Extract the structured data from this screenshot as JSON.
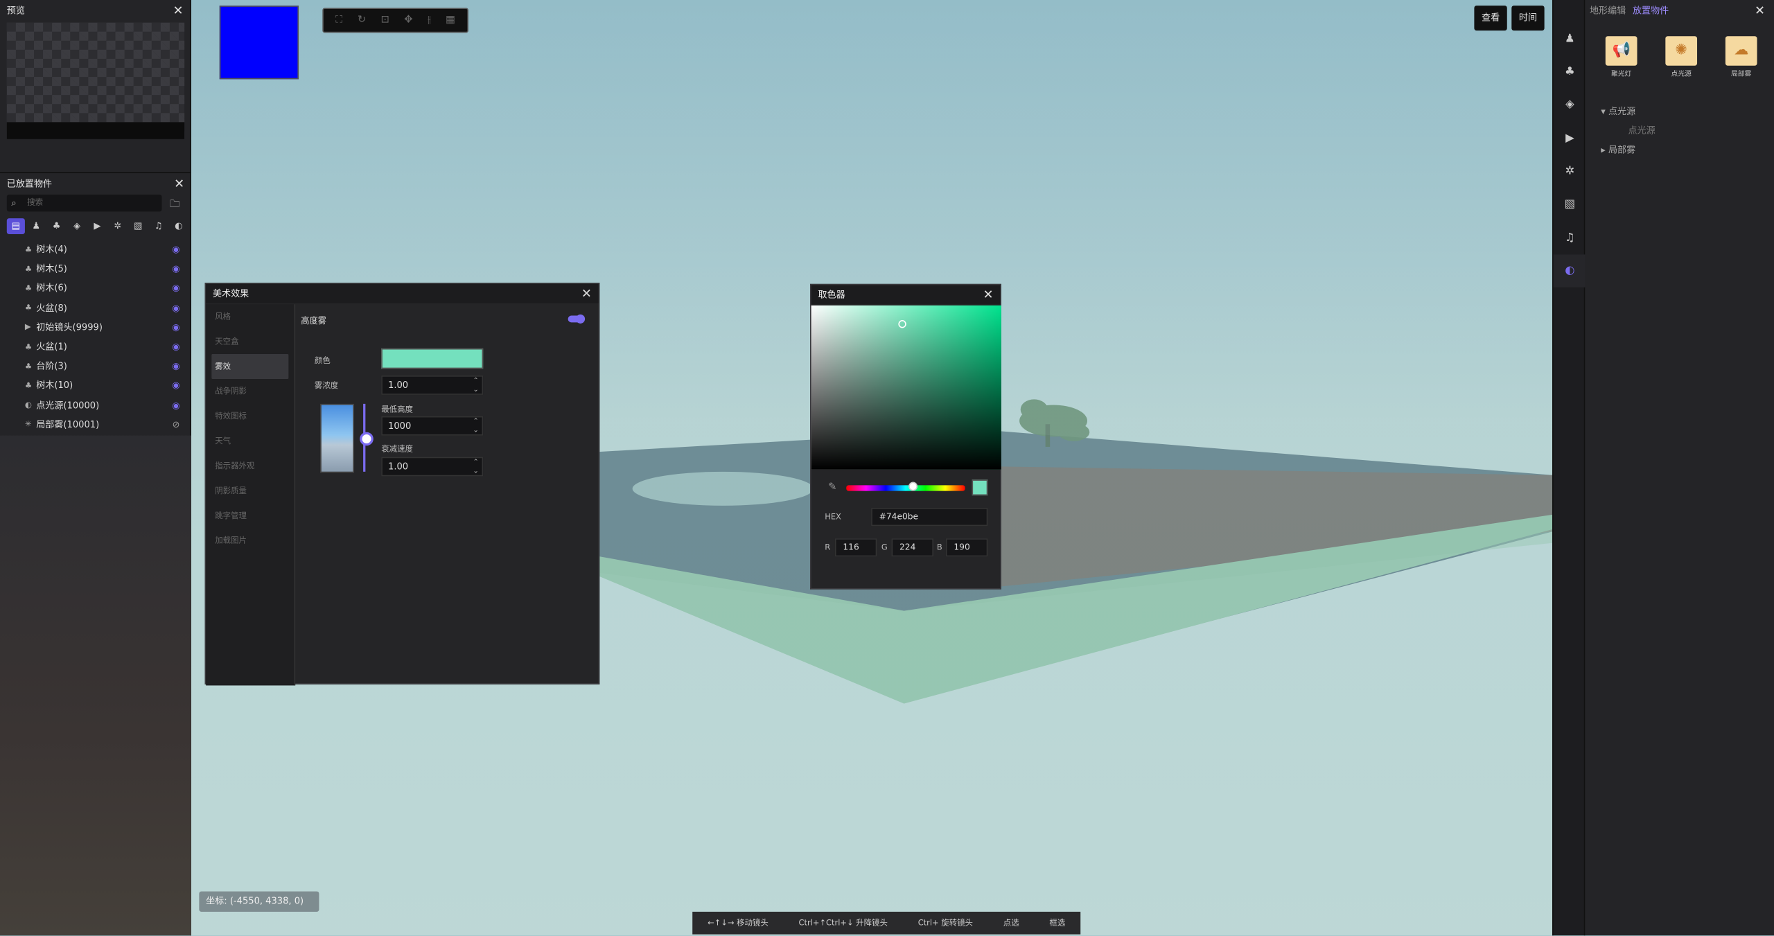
{
  "left_panel": {
    "preview_title": "预览",
    "placed_title": "已放置物件",
    "search_placeholder": "搜索",
    "items": [
      {
        "label": "树木(4)",
        "icon": "tree-icon",
        "visible": true
      },
      {
        "label": "树木(5)",
        "icon": "tree-icon",
        "visible": true
      },
      {
        "label": "树木(6)",
        "icon": "tree-icon",
        "visible": true
      },
      {
        "label": "火盆(8)",
        "icon": "tree-icon",
        "visible": true
      },
      {
        "label": "初始镜头(9999)",
        "icon": "camera-icon",
        "visible": true
      },
      {
        "label": "火盆(1)",
        "icon": "tree-icon",
        "visible": true
      },
      {
        "label": "台阶(3)",
        "icon": "tree-icon",
        "visible": true
      },
      {
        "label": "树木(10)",
        "icon": "tree-icon",
        "visible": true
      },
      {
        "label": "点光源(10000)",
        "icon": "light-icon",
        "visible": true
      },
      {
        "label": "局部雾(10001)",
        "icon": "fog-icon",
        "visible": false
      }
    ]
  },
  "viewport": {
    "view_button": "查看",
    "time_button": "时间",
    "coords": "坐标:  (-4550, 4338, 0)",
    "hints": [
      "←↑↓→ 移动镜头",
      "Ctrl+↑Ctrl+↓ 升降镜头",
      "Ctrl+ 旋转镜头",
      "点选",
      "框选"
    ]
  },
  "art_dialog": {
    "title": "美术效果",
    "nav": [
      "风格",
      "天空盒",
      "雾效",
      "战争阴影",
      "特效图标",
      "天气",
      "指示器外观",
      "阴影质量",
      "跳字管理",
      "加载图片"
    ],
    "active_nav": "雾效",
    "section": "高度雾",
    "color_label": "颜色",
    "color": "#74e0be",
    "density_label": "雾浓度",
    "density": "1.00",
    "min_height_label": "最低高度",
    "min_height": "1000",
    "falloff_label": "衰减速度",
    "falloff": "1.00"
  },
  "picker": {
    "title": "取色器",
    "hex_label": "HEX",
    "hex": "#74e0be",
    "r_label": "R",
    "r": "116",
    "g_label": "G",
    "g": "224",
    "b_label": "B",
    "b": "190"
  },
  "right_panel": {
    "tabs": [
      "地形编辑",
      "放置物件"
    ],
    "active_tab": "放置物件",
    "cards": [
      "聚光灯",
      "点光源",
      "局部雾"
    ],
    "tree": [
      "点光源",
      "点光源",
      "局部雾"
    ]
  },
  "colors": {
    "accent": "#7b6cf0",
    "sky": "#a9cbd2",
    "panel": "#242427"
  }
}
